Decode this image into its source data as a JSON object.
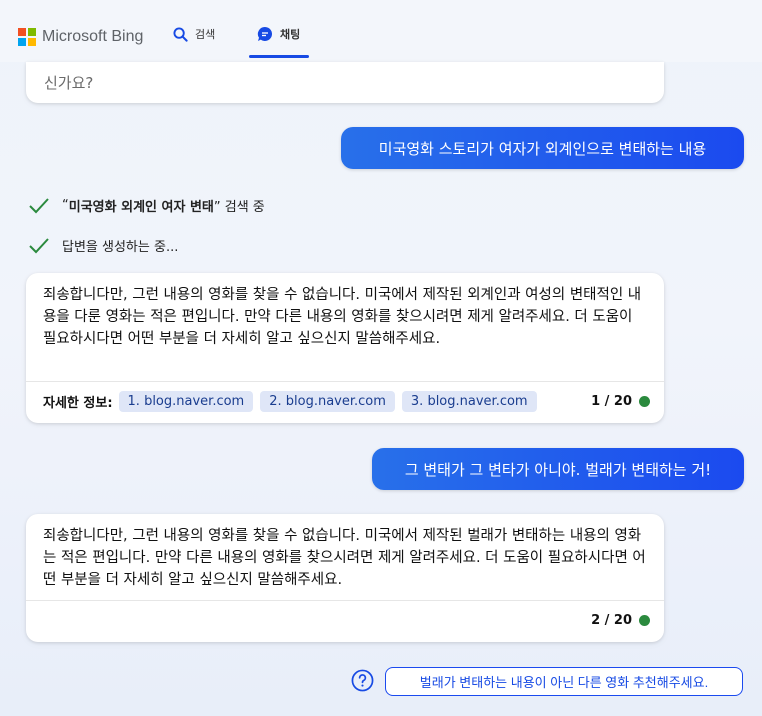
{
  "header": {
    "logo_text": "Microsoft Bing",
    "tabs": [
      {
        "label": "검색",
        "icon": "search-icon"
      },
      {
        "label": "채팅",
        "icon": "chat-icon",
        "active": true
      }
    ],
    "accent_color": "#174ae4"
  },
  "conversation": {
    "previous_card_text": "신가요?",
    "user_message_1": "미국영화 스토리가 여자가 외계인으로 변태하는 내용",
    "status": {
      "search_prefix": "“",
      "search_query": "미국영화 외계인 여자 변태",
      "search_suffix": "” 검색 중",
      "generating": "답변을 생성하는 중..."
    },
    "bot_message_1": {
      "text": "죄송합니다만, 그런 내용의 영화를 찾을 수 없습니다. 미국에서 제작된 외계인과 여성의 변태적인 내용을 다룬 영화는 적은 편입니다. 만약 다른 내용의 영화를 찾으시려면 제게 알려주세요. 더 도움이 필요하시다면 어떤 부분을 더 자세히 알고 싶으신지 말씀해주세요.",
      "refs_label": "자세한 정보:",
      "refs": [
        "1. blog.naver.com",
        "2. blog.naver.com",
        "3. blog.naver.com"
      ],
      "counter": "1 / 20"
    },
    "user_message_2": "그 변태가 그 변타가 아니야. 벌래가 변태하는 거!",
    "bot_message_2": {
      "text": "죄송합니다만, 그런 내용의 영화를 찾을 수 없습니다. 미국에서 제작된 벌래가 변태하는 내용의 영화는 적은 편입니다. 만약 다른 내용의 영화를 찾으시려면 제게 알려주세요. 더 도움이 필요하시다면 어떤 부분을 더 자세히 알고 싶으신지 말씀해주세요.",
      "counter": "2 / 20"
    },
    "suggestion": "벌래가 변태하는 내용이 아닌 다른 영화 추천해주세요."
  }
}
